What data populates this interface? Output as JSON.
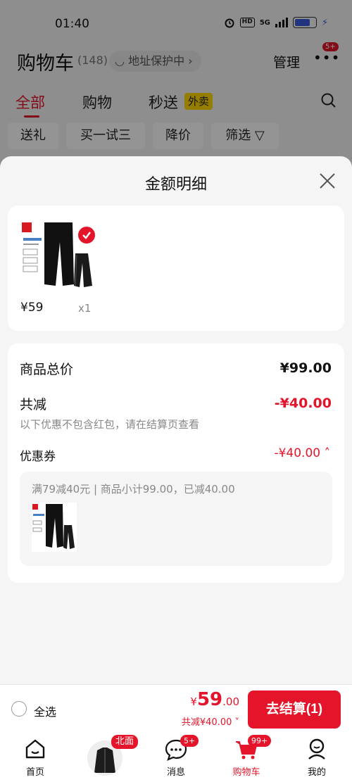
{
  "status_bar": {
    "time": "01:40",
    "hd": "HD",
    "signal": "5G",
    "bolt": "⚡"
  },
  "header": {
    "title": "购物车",
    "count": "(148)",
    "address_protect": "地址保护中",
    "address_chevron": "›",
    "manage": "管理",
    "more_dots": "•••",
    "more_badge": "5+"
  },
  "tabs": [
    {
      "label": "全部"
    },
    {
      "label": "购物"
    },
    {
      "label": "秒送"
    }
  ],
  "waimai_badge": "外卖",
  "chips": [
    "送礼",
    "买一试三",
    "降价",
    "筛选 ▽"
  ],
  "sheet": {
    "title": "金额明细",
    "product": {
      "price": "¥59",
      "qty": "x1"
    },
    "detail": {
      "total_label": "商品总价",
      "total_value": "¥99.00",
      "reduce_label": "共减",
      "reduce_value": "-¥40.00",
      "note": "以下优惠不包含红包，请在结算页查看",
      "coupon_label": "优惠券",
      "coupon_value": "-¥40.00 ˄",
      "coupon_desc": "满79减40元 | 商品小计99.00，已减40.00"
    }
  },
  "checkout": {
    "select_all": "全选",
    "currency": "¥",
    "amount_int": "59",
    "amount_dec": ".00",
    "reduced": "共减¥40.00 ˅",
    "button": "去结算(1)"
  },
  "bottom_nav": {
    "home": "首页",
    "beimian_badge": "北面",
    "messages": "消息",
    "messages_badge": "5+",
    "cart": "购物车",
    "cart_badge": "99+",
    "mine": "我的"
  },
  "colors": {
    "accent": "#e4152b",
    "waimai": "#ffd800"
  }
}
